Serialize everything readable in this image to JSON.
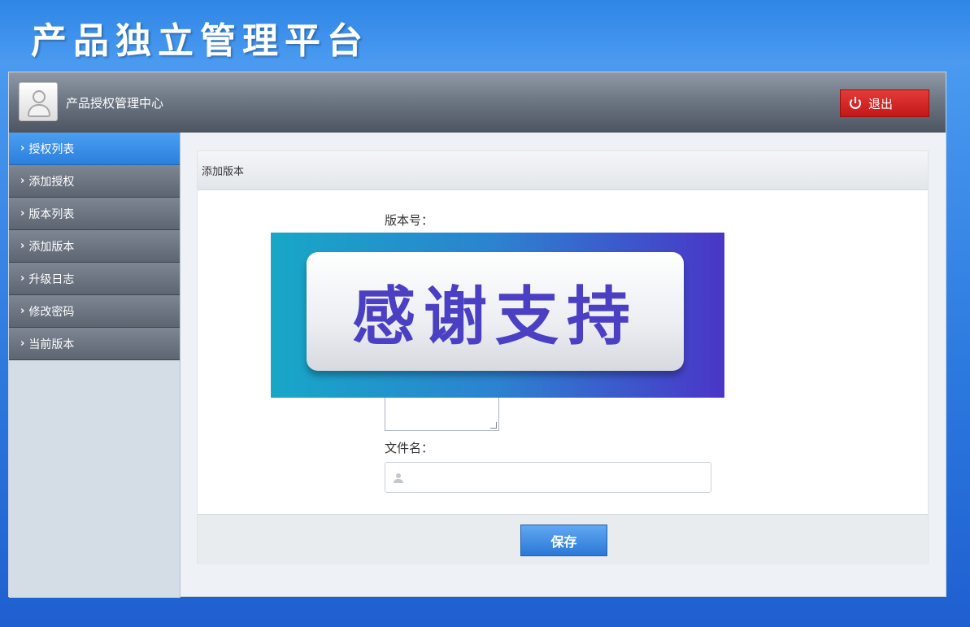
{
  "app": {
    "title": "产品独立管理平台"
  },
  "header": {
    "center_title": "产品授权管理中心",
    "logout_label": "退出"
  },
  "sidebar": {
    "items": [
      {
        "label": "授权列表",
        "active": true
      },
      {
        "label": "添加授权",
        "active": false
      },
      {
        "label": "版本列表",
        "active": false
      },
      {
        "label": "添加版本",
        "active": false
      },
      {
        "label": "升级日志",
        "active": false
      },
      {
        "label": "修改密码",
        "active": false
      },
      {
        "label": "当前版本",
        "active": false
      }
    ]
  },
  "panel": {
    "title": "添加版本",
    "version_label": "版本号：",
    "file_label": "文件名：",
    "file_value": "",
    "banner_text": "感谢支持",
    "save_label": "保存"
  },
  "colors": {
    "accent": "#2c7fdc",
    "logout": "#c41818",
    "banner_text": "#4b3fc3"
  }
}
